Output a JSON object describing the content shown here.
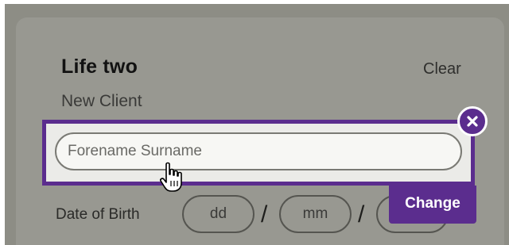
{
  "life": {
    "title": "Life two",
    "subtitle": "New Client",
    "clear_label": "Clear"
  },
  "name_popup": {
    "placeholder": "Forename Surname",
    "value": "",
    "close_icon": "close-icon",
    "change_label": "Change"
  },
  "dob": {
    "label": "Date of Birth",
    "day_placeholder": "dd",
    "month_placeholder": "mm",
    "separator": "/"
  },
  "colors": {
    "accent": "#5b2d8e",
    "overlay": "#8d8d85",
    "card": "#989891"
  },
  "cursor_icon": "hand-pointer-icon"
}
